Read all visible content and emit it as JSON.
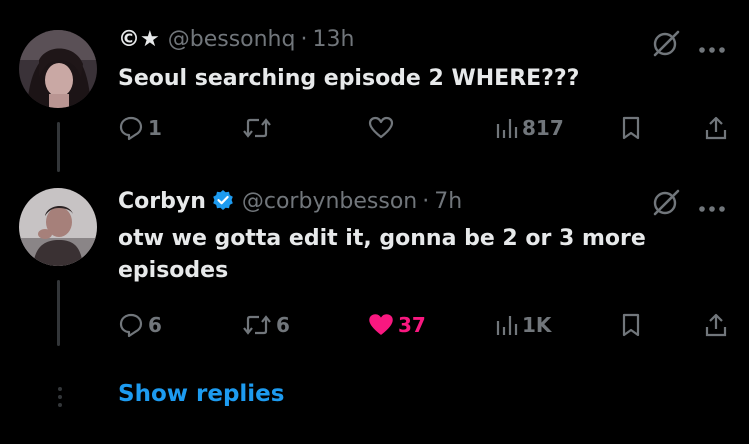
{
  "tweets": [
    {
      "display_name": "©★",
      "handle": "@bessonhq",
      "separator": "·",
      "time": "13h",
      "text": "Seoul searching episode 2 WHERE???",
      "verified": false,
      "replies": "1",
      "reposts": "",
      "likes": "",
      "views": "817",
      "liked": false
    },
    {
      "display_name": "Corbyn",
      "handle": "@corbynbesson",
      "separator": "·",
      "time": "7h",
      "text": "otw we gotta edit it, gonna be 2 or 3 more episodes",
      "verified": true,
      "replies": "6",
      "reposts": "6",
      "likes": "37",
      "views": "1K",
      "liked": true
    }
  ],
  "show_replies_label": "Show replies",
  "icons": {
    "reply": "reply-icon",
    "repost": "repost-icon",
    "like": "heart-icon",
    "views": "views-icon",
    "bookmark": "bookmark-icon",
    "share": "share-icon",
    "grok": "grok-icon",
    "more": "more-icon",
    "verified": "verified-badge-icon"
  },
  "colors": {
    "background": "#000000",
    "text": "#e7e9ea",
    "secondary": "#71767b",
    "link": "#1d9bf0",
    "like": "#f91880",
    "verified": "#1d9bf0"
  }
}
